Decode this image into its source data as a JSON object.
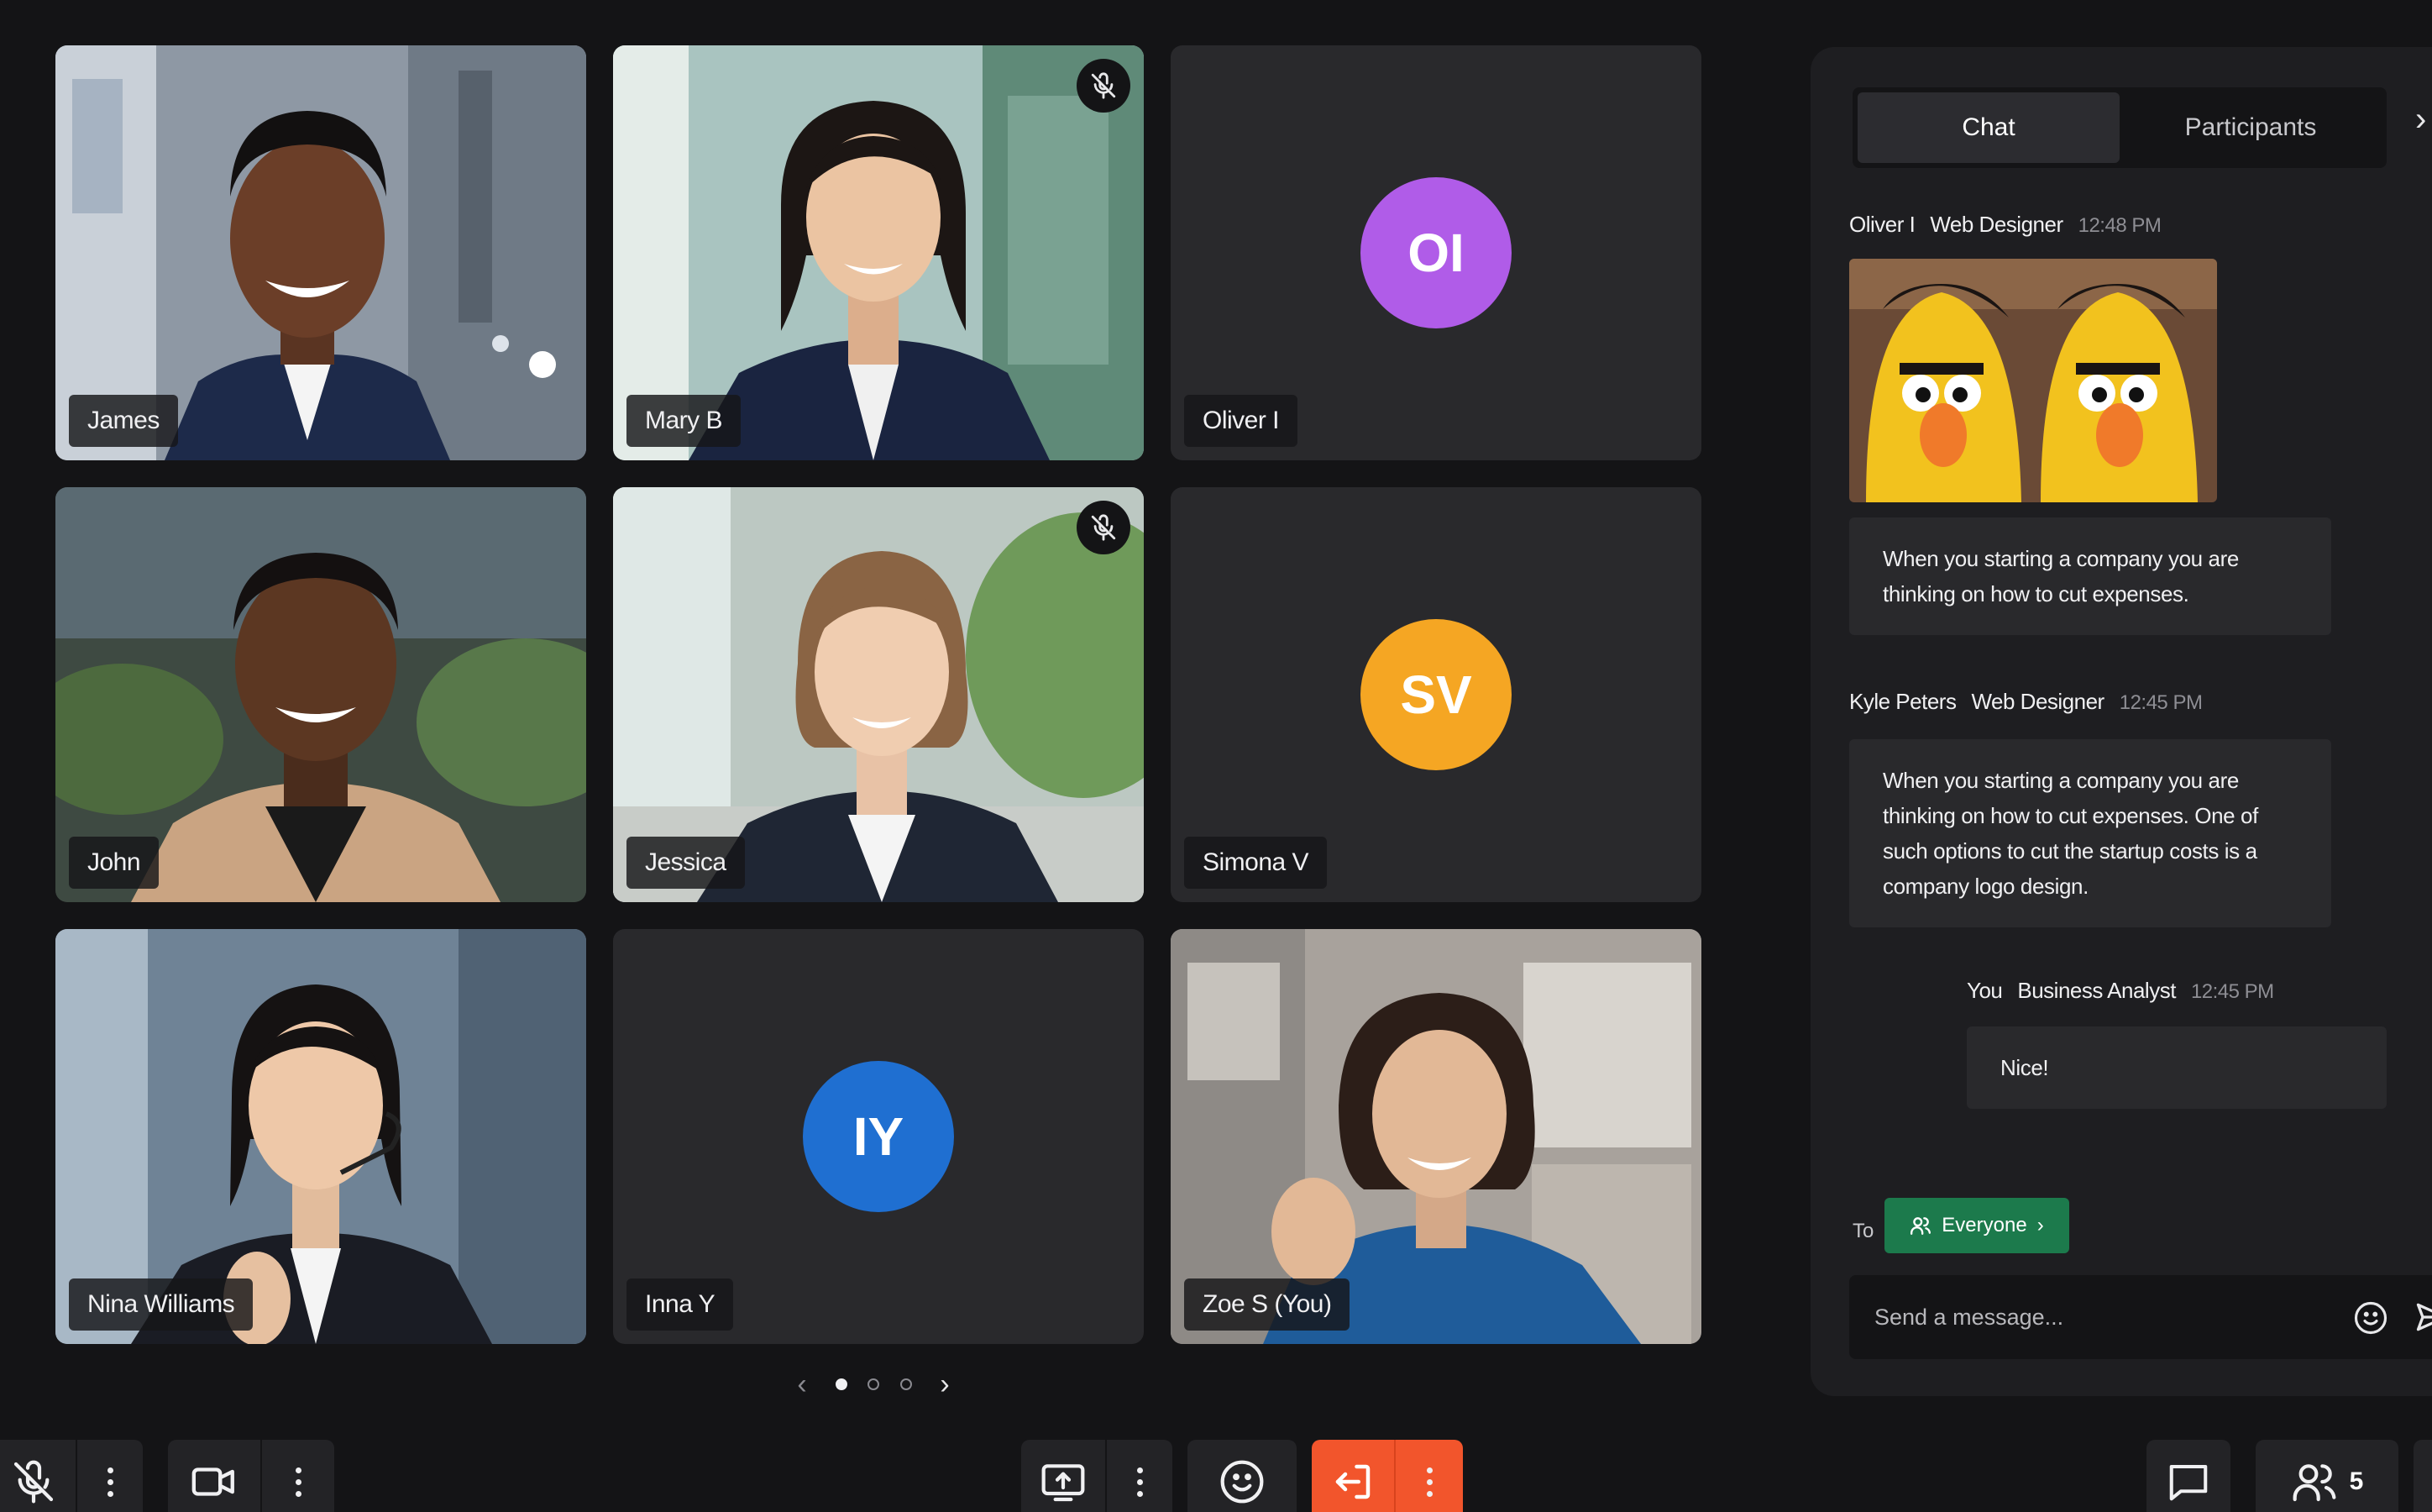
{
  "participants": [
    {
      "name": "James",
      "type": "video",
      "muted": false
    },
    {
      "name": "Mary B",
      "type": "video",
      "muted": true
    },
    {
      "name": "Oliver I",
      "type": "avatar",
      "initials": "OI",
      "color": "#b05ce8"
    },
    {
      "name": "John",
      "type": "video",
      "muted": false
    },
    {
      "name": "Jessica",
      "type": "video",
      "muted": true
    },
    {
      "name": "Simona V",
      "type": "avatar",
      "initials": "SV",
      "color": "#f5a623"
    },
    {
      "name": "Nina Williams",
      "type": "video",
      "muted": false
    },
    {
      "name": "Inna Y",
      "type": "avatar",
      "initials": "IY",
      "color": "#1f6fd1"
    },
    {
      "name": "Zoe S (You)",
      "type": "video",
      "muted": false
    }
  ],
  "pager": {
    "pages": 3,
    "current": 1,
    "prev_icon": "‹",
    "next_icon": "›"
  },
  "chat": {
    "tabs": [
      {
        "label": "Chat",
        "active": true
      },
      {
        "label": "Participants",
        "active": false
      }
    ],
    "collapse_icon": "›",
    "messages": [
      {
        "sender": "Oliver I",
        "role": "Web Designer",
        "time": "12:48 PM",
        "has_gif": true,
        "text": "When you starting a company you are thinking on how to cut expenses."
      },
      {
        "sender": "Kyle Peters",
        "role": "Web Designer",
        "time": "12:45 PM",
        "has_gif": false,
        "text": "When you starting a company you are thinking on how to cut expenses. One of such options to cut the startup costs is a company logo design."
      },
      {
        "sender": "You",
        "role": "Business Analyst",
        "time": "12:45 PM",
        "has_gif": false,
        "text": "Nice!"
      }
    ],
    "to_label": "To",
    "recipient": "Everyone",
    "recipient_chevron": "›",
    "input_placeholder": "Send a message..."
  },
  "controls": {
    "participant_count": "5",
    "accent_leave": "#f2552c",
    "accent_everyone": "#1c7a4c"
  }
}
